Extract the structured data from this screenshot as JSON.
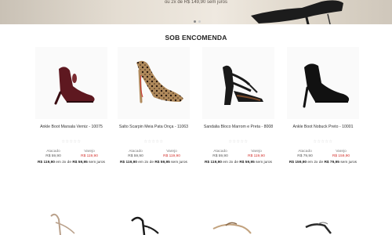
{
  "hero": {
    "text": "ou 2x de R$ 149,90 sem juros",
    "dot_active": "#cccccc",
    "dot_inactive": "#888888"
  },
  "section": {
    "title": "SOB ENCOMENDA"
  },
  "products": [
    {
      "name": "Ankle Boot Marsala Verniz - 10075",
      "stars": "☆☆☆☆☆",
      "atacado_label": "Atacado",
      "atacado_value": "R$ 59,90",
      "varejo_label": "Varejo",
      "varejo_value": "R$ 119,90",
      "installment_price": "R$ 119,90",
      "installment_mid": "em 2x de",
      "installment_part": "R$ 59,95",
      "installment_suffix": "sem juros",
      "color": "#5e1820"
    },
    {
      "name": "Salto Scarpin Meia Pata Onça - 11063",
      "stars": "☆☆☆☆☆",
      "atacado_label": "Atacado",
      "atacado_value": "R$ 59,90",
      "varejo_label": "Varejo",
      "varejo_value": "R$ 119,90",
      "installment_price": "R$ 119,90",
      "installment_mid": "em 2x de",
      "installment_part": "R$ 59,95",
      "installment_suffix": "sem juros",
      "color": "#8a6a45"
    },
    {
      "name": "Sandalia Bloco Marrom e Preta - 8008",
      "stars": "☆☆☆☆☆",
      "atacado_label": "Atacado",
      "atacado_value": "R$ 59,90",
      "varejo_label": "Varejo",
      "varejo_value": "R$ 119,90",
      "installment_price": "R$ 119,90",
      "installment_mid": "em 2x de",
      "installment_part": "R$ 59,95",
      "installment_suffix": "sem juros",
      "color": "#1a1a1a"
    },
    {
      "name": "Ankle Boot Nobuck Preto - 10001",
      "stars": "☆☆☆☆☆",
      "atacado_label": "Atacado",
      "atacado_value": "R$ 79,90",
      "varejo_label": "Varejo",
      "varejo_value": "R$ 159,90",
      "installment_price": "R$ 159,90",
      "installment_mid": "em 2x de",
      "installment_part": "R$ 79,95",
      "installment_suffix": "sem juros",
      "color": "#111111"
    }
  ],
  "colors": {
    "price_red": "#d3312c",
    "star_empty": "#cccccc"
  }
}
